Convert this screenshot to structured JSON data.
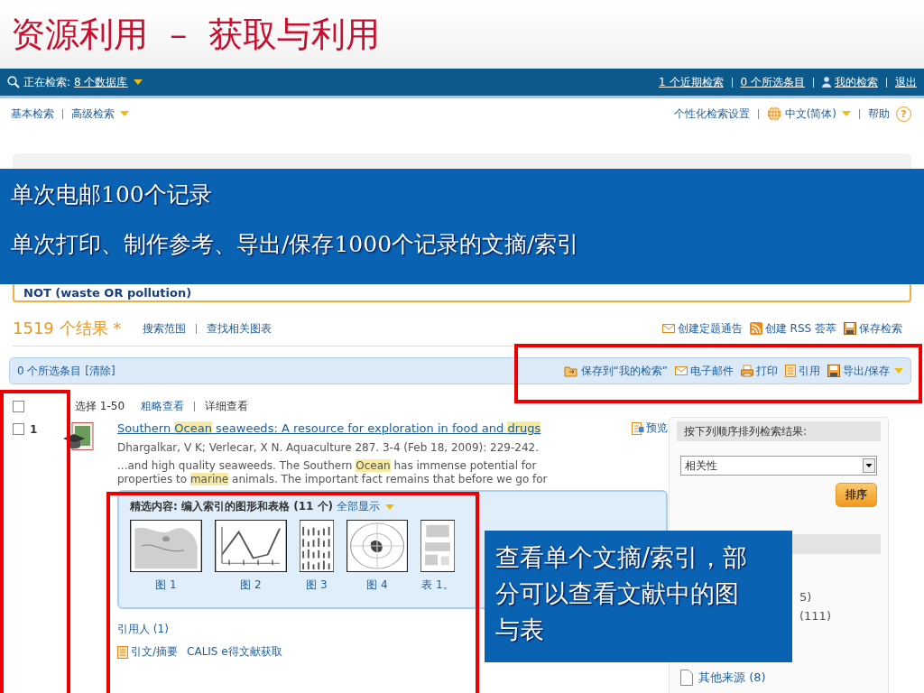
{
  "slide": {
    "title": "资源利用  –  获取与利用"
  },
  "topbar": {
    "searching_label": "正在检索:",
    "databases_link": "8 个数据库",
    "links": [
      {
        "text": "1 个近期检索",
        "kind": "plain"
      },
      {
        "text": "0 个所选条目",
        "kind": "plain"
      },
      {
        "text": "我的检索",
        "kind": "account"
      },
      {
        "text": "退出",
        "kind": "plain"
      }
    ]
  },
  "subnav": {
    "left": [
      {
        "text": "基本检索",
        "dropdown": false
      },
      {
        "text": "高级检索",
        "dropdown": true
      }
    ],
    "right": [
      {
        "text": "个性化检索设置",
        "kind": "plain",
        "dropdown": false
      },
      {
        "text": "中文(简体)",
        "kind": "language",
        "dropdown": true
      },
      {
        "text": "帮助",
        "kind": "help",
        "dropdown": false
      }
    ],
    "help_glyph": "?"
  },
  "search": {
    "query_tail": "NOT (waste OR pollution)"
  },
  "results": {
    "count": "1519 个结果 *",
    "links": [
      "搜索范围",
      "查找相关图表"
    ],
    "actions": [
      {
        "text": "创建定题通告",
        "kind": "mail"
      },
      {
        "text": "创建 RSS 荟萃",
        "kind": "rss"
      },
      {
        "text": "保存检索",
        "kind": "save"
      }
    ]
  },
  "selection_bar": {
    "text": "0 个所选条目 [清除]",
    "actions": [
      {
        "text": "保存到“我的检索”",
        "kind": "folder",
        "dropdown": false
      },
      {
        "text": "电子邮件",
        "kind": "mail",
        "dropdown": false
      },
      {
        "text": "打印",
        "kind": "print",
        "dropdown": false
      },
      {
        "text": "引用",
        "kind": "doc",
        "dropdown": false
      },
      {
        "text": "导出/保存",
        "kind": "save",
        "dropdown": true
      }
    ]
  },
  "list_header": {
    "select_all": {
      "label": "选择 1-50",
      "checked": false
    },
    "views": [
      {
        "text": "粗略查看",
        "selected": false
      },
      {
        "text": "详细查看",
        "selected": true
      }
    ]
  },
  "result": {
    "number": "1",
    "checked": false,
    "title": [
      {
        "text": "Southern ",
        "highlight": false
      },
      {
        "text": "Ocean",
        "highlight": true
      },
      {
        "text": " seaweeds: A resource for exploration in food and ",
        "highlight": false
      },
      {
        "text": "drugs",
        "highlight": true
      }
    ],
    "preview": "预览",
    "authors": "Dhargalkar, V K; Verlecar, X N. Aquaculture 287. 3-4  (Feb 18, 2009): 229-242.",
    "snippet": [
      [
        {
          "text": "...and high quality seaweeds. The Southern ",
          "highlight": false
        },
        {
          "text": "Ocean",
          "highlight": true
        },
        {
          "text": " has immense potential for",
          "highlight": false
        }
      ],
      [
        {
          "text": "properties to ",
          "highlight": false
        },
        {
          "text": "marine",
          "highlight": true
        },
        {
          "text": " animals. The important fact remains that before we go for",
          "highlight": false
        }
      ]
    ],
    "featured": {
      "heading": "精选内容: 编入索引的图形和表格 (11 个)",
      "show_all": "全部显示",
      "items": [
        {
          "caption": "图 1",
          "kind": "map"
        },
        {
          "caption": "图 2",
          "kind": "line"
        },
        {
          "caption": "图 3",
          "kind": "bars"
        },
        {
          "caption": "图 4",
          "kind": "polar"
        },
        {
          "caption": "表 1。",
          "kind": "table"
        }
      ]
    },
    "cited_by": "引用人 (1)",
    "links": [
      {
        "text": "引文/摘要",
        "kind": "doc"
      },
      {
        "text": "CALIS e得文献获取",
        "kind": "plain"
      }
    ]
  },
  "sidebar": {
    "sort_heading": "按下列顺序排列检索结果:",
    "sort_value": "相关性",
    "sort_button": "排序",
    "items": [
      {
        "kind": "partial",
        "text": "5)"
      },
      {
        "kind": "partial",
        "text": "(111)"
      },
      {
        "kind": "source",
        "text": "其他来源 (8)"
      }
    ]
  },
  "callouts": [
    {
      "kind": "banner",
      "lines": [
        "单次电邮100个记录",
        "单次打印、制作参考、导出/保存1000个记录的文摘/索引"
      ]
    },
    {
      "kind": "note",
      "lines": [
        "查看单个文摘/索引，部分可以查看文献中的图与表"
      ]
    }
  ]
}
